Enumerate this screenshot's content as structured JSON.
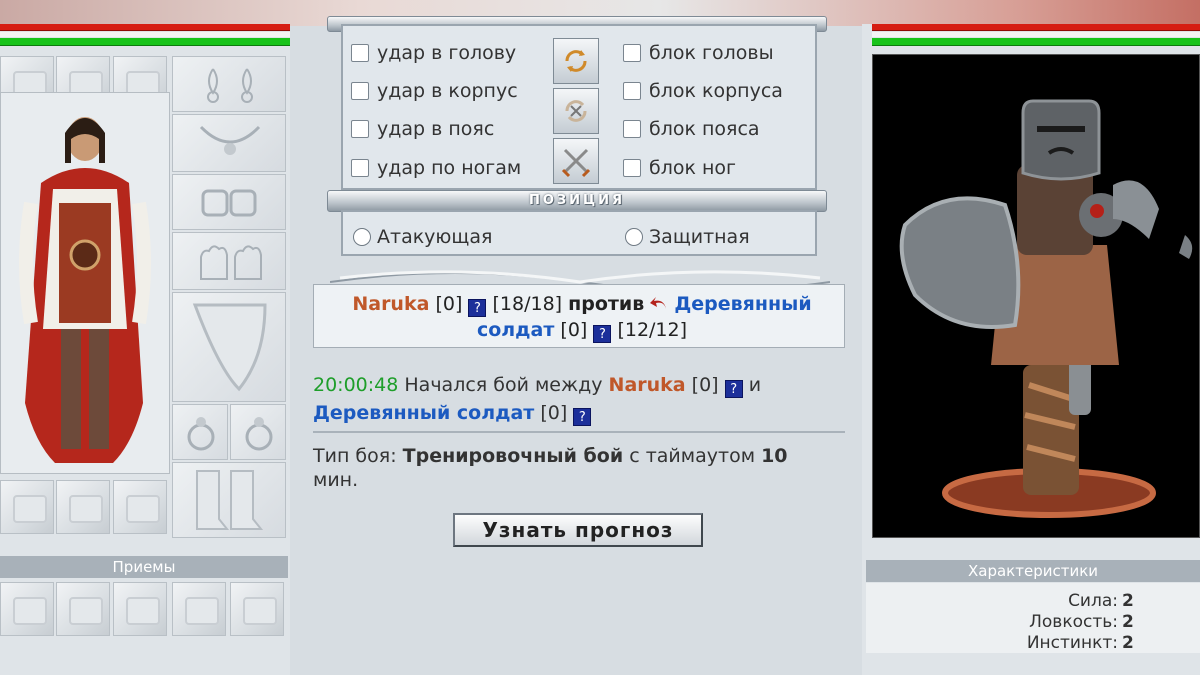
{
  "attack": {
    "items": [
      "удар в голову",
      "удар в корпус",
      "удар в пояс",
      "удар по ногам"
    ]
  },
  "block": {
    "items": [
      "блок головы",
      "блок корпуса",
      "блок пояса",
      "блок ног"
    ]
  },
  "position": {
    "title": "ПОЗИЦИЯ",
    "options": [
      "Атакующая",
      "Защитная"
    ]
  },
  "versus": {
    "player_name": "Naruka",
    "player_level": "[0]",
    "player_hp": "[18/18]",
    "vs_label": "против",
    "enemy_name_1": "Деревянный",
    "enemy_name_2": "солдат",
    "enemy_level": "[0]",
    "enemy_hp": "[12/12]",
    "info_icon_label": "?"
  },
  "log": {
    "time": "20:00:48",
    "text_1": "Начался бой между",
    "player_name": "Naruka",
    "player_level": "[0]",
    "and": "и",
    "enemy_name": "Деревянный солдат",
    "enemy_level": "[0]"
  },
  "info": {
    "type_label": "Тип боя:",
    "type_value": "Тренировочный бой",
    "timeout_label": "с таймаутом",
    "timeout_value": "10",
    "timeout_unit": "мин."
  },
  "forecast_button": "Узнать прогноз",
  "left_panel": {
    "techniques_title": "Приемы"
  },
  "right_panel": {
    "stats_title": "Характеристики",
    "stats": [
      {
        "label": "Сила:",
        "value": "2"
      },
      {
        "label": "Ловкость:",
        "value": "2"
      },
      {
        "label": "Инстинкт:",
        "value": "2"
      }
    ]
  },
  "hp": {
    "player_fraction": 1.0,
    "enemy_fraction": 1.0
  },
  "colors": {
    "player_name": "#c0582a",
    "enemy_name": "#1c5ac0",
    "hp_red": "#d61d12",
    "hp_green": "#18c31a",
    "timestamp": "#1e9e2a"
  }
}
